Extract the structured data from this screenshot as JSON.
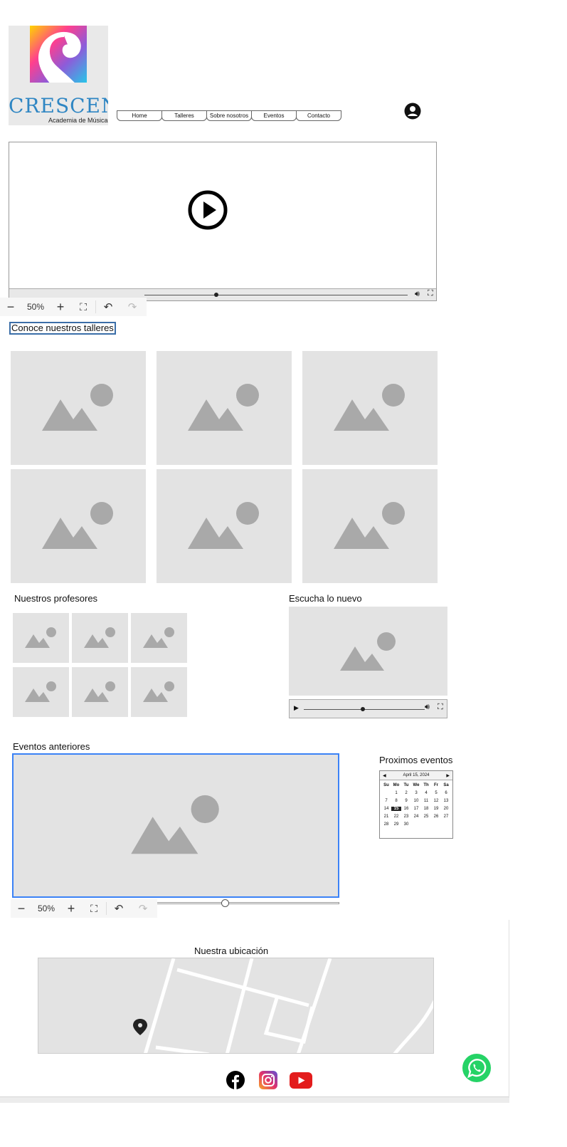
{
  "logo": {
    "wordmark": "CRESCENDO",
    "subtitle": "Academia de Música"
  },
  "nav": {
    "items": [
      "Home",
      "Talleres",
      "Sobre nosotros",
      "Eventos",
      "Contacto"
    ]
  },
  "top_zoom": {
    "level": "50%",
    "minus": "−",
    "plus": "+"
  },
  "workshops": {
    "title": "Conoce nuestros talleres"
  },
  "teachers": {
    "title": "Nuestros profesores"
  },
  "listen": {
    "title": "Escucha lo nuevo"
  },
  "past_events": {
    "title": "Eventos anteriores"
  },
  "bottom_zoom": {
    "level": "50%",
    "minus": "−",
    "plus": "+"
  },
  "upcoming": {
    "title": "Proximos eventos",
    "calendar": {
      "month_label": "April 15, 2024",
      "weekdays": [
        "Su",
        "Mo",
        "Tu",
        "We",
        "Th",
        "Fr",
        "Sa"
      ],
      "weeks": [
        [
          "",
          "1",
          "2",
          "3",
          "4",
          "5",
          "6"
        ],
        [
          "7",
          "8",
          "9",
          "10",
          "11",
          "12",
          "13"
        ],
        [
          "14",
          "15",
          "16",
          "17",
          "18",
          "19",
          "20"
        ],
        [
          "21",
          "22",
          "23",
          "24",
          "25",
          "26",
          "27"
        ],
        [
          "28",
          "29",
          "30",
          "",
          "",
          "",
          ""
        ]
      ],
      "selected": "15"
    }
  },
  "location": {
    "title": "Nuestra ubicación"
  },
  "social": [
    "facebook-icon",
    "instagram-icon",
    "youtube-icon"
  ],
  "colors": {
    "logo_blue": "#2f86c3",
    "placeholder": "#e3e3e3",
    "selection_blue": "#3b82f6",
    "whatsapp": "#25d366",
    "youtube": "#e31c1c"
  }
}
